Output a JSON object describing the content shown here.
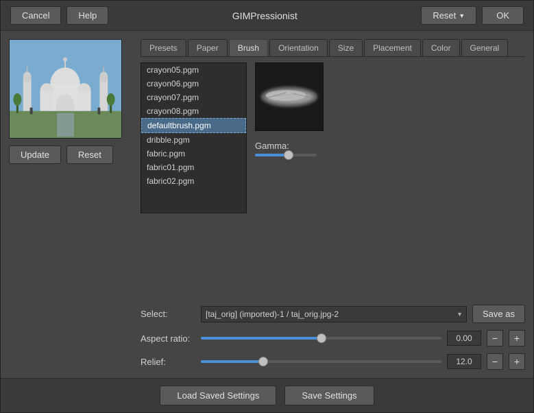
{
  "header": {
    "cancel_label": "Cancel",
    "help_label": "Help",
    "title": "GIMPressionist",
    "reset_label": "Reset",
    "ok_label": "OK"
  },
  "tabs": {
    "items": [
      "Presets",
      "Paper",
      "Brush",
      "Orientation",
      "Size",
      "Placement",
      "Color",
      "General"
    ],
    "active": "Brush"
  },
  "brush_list": {
    "items": [
      "crayon05.pgm",
      "crayon06.pgm",
      "crayon07.pgm",
      "crayon08.pgm",
      "defaultbrush.pgm",
      "dribble.pgm",
      "fabric.pgm",
      "fabric01.pgm",
      "fabric02.pgm"
    ],
    "selected": "defaultbrush.pgm"
  },
  "gamma": {
    "label": "Gamma:",
    "value": 55
  },
  "select": {
    "label": "Select:",
    "value": "[taj_orig] (imported)-1 / taj_orig.jpg-2",
    "options": [
      "[taj_orig] (imported)-1 / taj_orig.jpg-2"
    ]
  },
  "save_as_label": "Save as",
  "aspect_ratio": {
    "label": "Aspect ratio:",
    "value": "0.00",
    "pct": 50
  },
  "relief": {
    "label": "Relief:",
    "value": "12.0",
    "pct": 25
  },
  "footer": {
    "load_label": "Load Saved Settings",
    "save_label": "Save Settings"
  },
  "left_buttons": {
    "update_label": "Update",
    "reset_label": "Reset"
  },
  "icons": {
    "minus": "−",
    "plus": "+",
    "chevron_down": "▼"
  }
}
